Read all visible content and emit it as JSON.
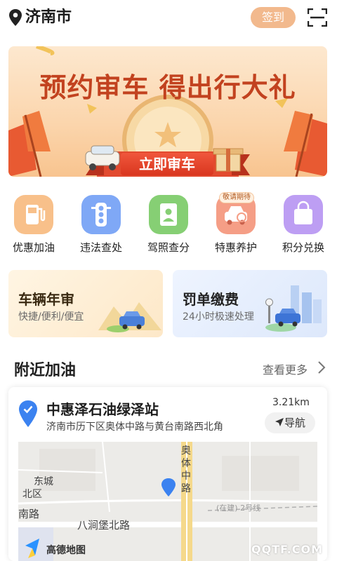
{
  "header": {
    "city": "济南市",
    "checkin_label": "签到",
    "location_icon": "location-pin-icon",
    "scan_icon": "scan-icon"
  },
  "banner": {
    "title": "预约审车 得出行大礼",
    "button_label": "立即审车",
    "colors": {
      "bg": "#fbd5ac",
      "title": "#c2421f",
      "button": "#e0412a"
    }
  },
  "services": [
    {
      "label": "优惠加油",
      "icon": "fuel-pump-icon",
      "color": "#f6b16e"
    },
    {
      "label": "违法查处",
      "icon": "traffic-light-icon",
      "color": "#6e9ef5"
    },
    {
      "label": "驾照查分",
      "icon": "license-icon",
      "color": "#7cc96a"
    },
    {
      "label": "特惠养护",
      "icon": "car-care-icon",
      "color": "#f38b74",
      "badge": "敬请期待"
    },
    {
      "label": "积分兑换",
      "icon": "shopping-bag-icon",
      "color": "#b796f2"
    }
  ],
  "cards": {
    "inspection": {
      "title": "车辆年审",
      "subtitle": "快捷/便利/便宜"
    },
    "fines": {
      "title": "罚单缴费",
      "subtitle": "24小时极速处理"
    }
  },
  "nearby": {
    "title": "附近加油",
    "more_label": "查看更多",
    "station": {
      "name": "中惠泽石油绿泽站",
      "distance": "3.21km",
      "address": "济南市历下区奥体中路与黄台南路西北角",
      "nav_label": "导航"
    },
    "map": {
      "road_vertical": "奥体中路",
      "road_horizontal": "八涧堡北路",
      "district_1": "东城",
      "district_2": "北区",
      "road_left": "南路",
      "construction": "(在建) 2号线",
      "provider": "高德地图"
    }
  },
  "watermark": "QQTF.COM"
}
